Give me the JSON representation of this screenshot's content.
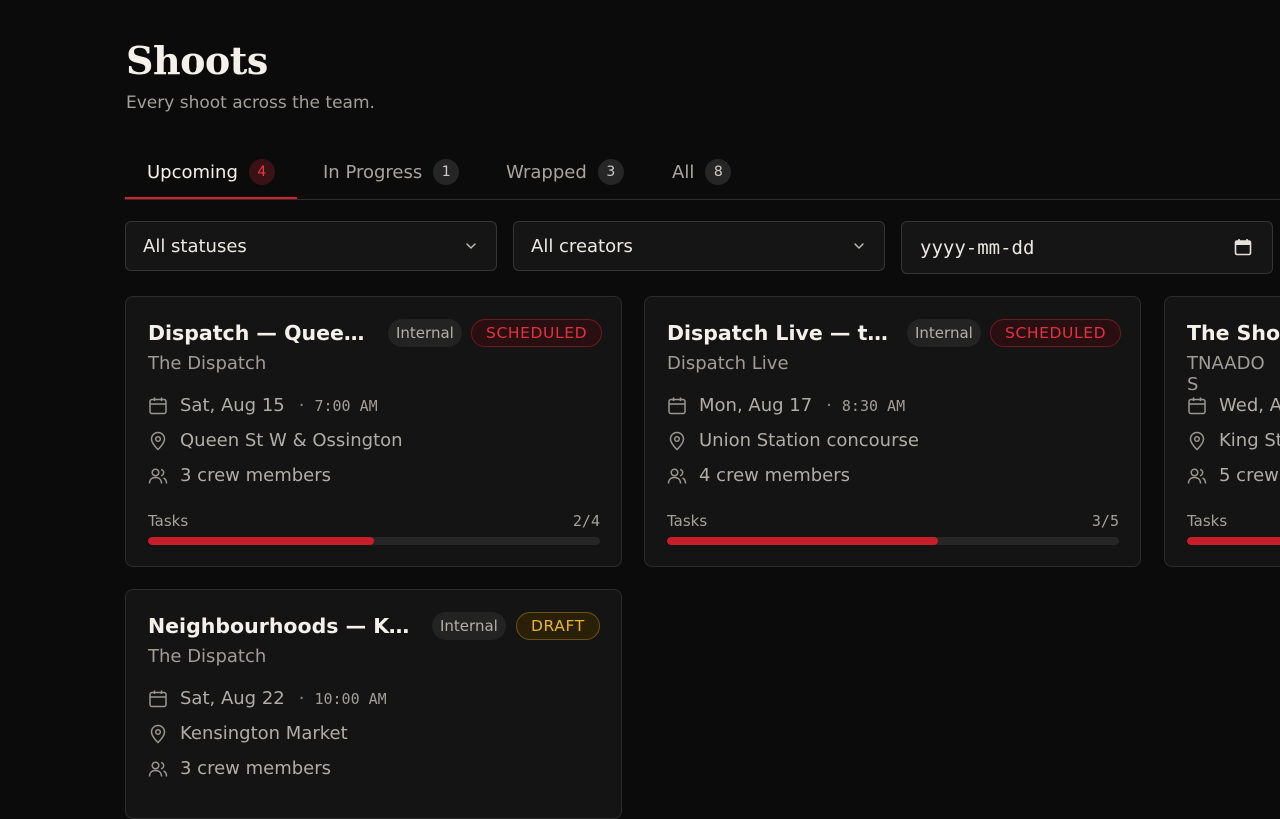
{
  "header": {
    "title": "Shoots",
    "subtitle": "Every shoot across the team."
  },
  "tabs": [
    {
      "label": "Upcoming",
      "count": "4",
      "active": true
    },
    {
      "label": "In Progress",
      "count": "1",
      "active": false
    },
    {
      "label": "Wrapped",
      "count": "3",
      "active": false
    },
    {
      "label": "All",
      "count": "8",
      "active": false
    }
  ],
  "filters": {
    "status": "All statuses",
    "creator": "All creators",
    "date_placeholder": "yyyy-mm-dd"
  },
  "colors": {
    "accent": "#d61f2c",
    "scheduled": "#e0323f",
    "draft": "#e8b42a",
    "background": "#0b0b0b"
  },
  "cards": [
    {
      "title": "Dispatch — Queen ...",
      "show": "The Dispatch",
      "visibility": "Internal",
      "status": "SCHEDULED",
      "date": "Sat, Aug 15",
      "time": "7:00 AM",
      "location": "Queen St W & Ossington",
      "crew": "3 crew members",
      "tasks_label": "Tasks",
      "tasks_count": "2/4",
      "tasks_progress": 0.5
    },
    {
      "title": "Dispatch Live — tra...",
      "show": "Dispatch Live",
      "visibility": "Internal",
      "status": "SCHEDULED",
      "date": "Mon, Aug 17",
      "time": "8:30 AM",
      "location": "Union Station concourse",
      "crew": "4 crew members",
      "tasks_label": "Tasks",
      "tasks_count": "3/5",
      "tasks_progress": 0.6
    },
    {
      "title": "The Show",
      "show": "TNAADO S",
      "date": "Wed, A",
      "location": "King St",
      "crew": "5 crew",
      "tasks_label": "Tasks"
    },
    {
      "title": "Neighbourhoods — Ken...",
      "show": "The Dispatch",
      "visibility": "Internal",
      "status": "DRAFT",
      "date": "Sat, Aug 22",
      "time": "10:00 AM",
      "location": "Kensington Market",
      "crew": "3 crew members"
    }
  ]
}
